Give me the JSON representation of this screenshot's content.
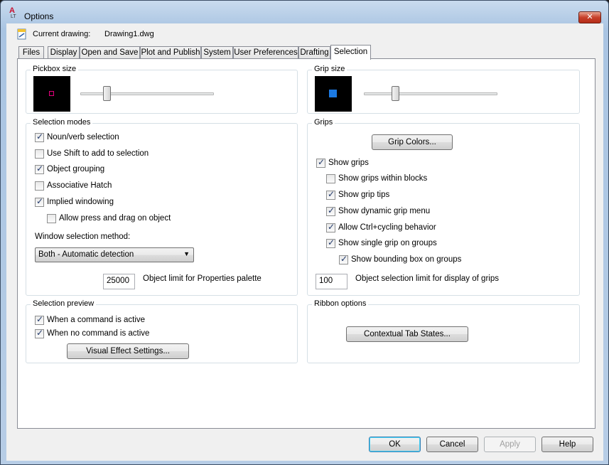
{
  "window": {
    "title": "Options",
    "close_glyph": "✕"
  },
  "header": {
    "current_drawing_label": "Current drawing:",
    "current_drawing_value": "Drawing1.dwg"
  },
  "tabs": [
    {
      "label": "Files"
    },
    {
      "label": "Display"
    },
    {
      "label": "Open and Save"
    },
    {
      "label": "Plot and Publish"
    },
    {
      "label": "System"
    },
    {
      "label": "User Preferences"
    },
    {
      "label": "Drafting"
    },
    {
      "label": "Selection",
      "active": true
    }
  ],
  "pickbox": {
    "title": "Pickbox size",
    "preview_color": "#e6007e",
    "slider_level": 0.18
  },
  "gripsize": {
    "title": "Grip size",
    "preview_color": "#1c7ae3",
    "slider_level": 0.22
  },
  "selection_modes": {
    "title": "Selection modes",
    "items": [
      {
        "label": "Noun/verb selection",
        "checked": true
      },
      {
        "label": "Use Shift to add to selection",
        "checked": false
      },
      {
        "label": "Object grouping",
        "checked": true
      },
      {
        "label": "Associative Hatch",
        "checked": false
      },
      {
        "label": "Implied windowing",
        "checked": true
      },
      {
        "label": "Allow press and drag on object",
        "checked": false
      }
    ],
    "window_method_label": "Window selection method:",
    "window_method_value": "Both - Automatic detection",
    "limit_value": "25000",
    "limit_label": "Object limit for Properties palette"
  },
  "grips": {
    "title": "Grips",
    "colors_button": "Grip Colors...",
    "items": [
      {
        "label": "Show grips",
        "checked": true
      },
      {
        "label": "Show grips within blocks",
        "checked": false
      },
      {
        "label": "Show grip tips",
        "checked": true
      },
      {
        "label": "Show dynamic grip menu",
        "checked": true
      },
      {
        "label": "Allow Ctrl+cycling behavior",
        "checked": true
      },
      {
        "label": "Show single grip on groups",
        "checked": true
      },
      {
        "label": "Show bounding box on groups",
        "checked": true
      }
    ],
    "limit_value": "100",
    "limit_label": "Object selection limit for display of grips"
  },
  "selection_preview": {
    "title": "Selection preview",
    "items": [
      {
        "label": "When a command is active",
        "checked": true
      },
      {
        "label": "When no command is active",
        "checked": true
      }
    ],
    "visual_button": "Visual Effect Settings..."
  },
  "ribbon": {
    "title": "Ribbon options",
    "contextual_button": "Contextual Tab States..."
  },
  "footer": {
    "ok": "OK",
    "cancel": "Cancel",
    "apply": "Apply",
    "help": "Help"
  },
  "check_glyph": "✓",
  "dropdown_arrow": "▼"
}
